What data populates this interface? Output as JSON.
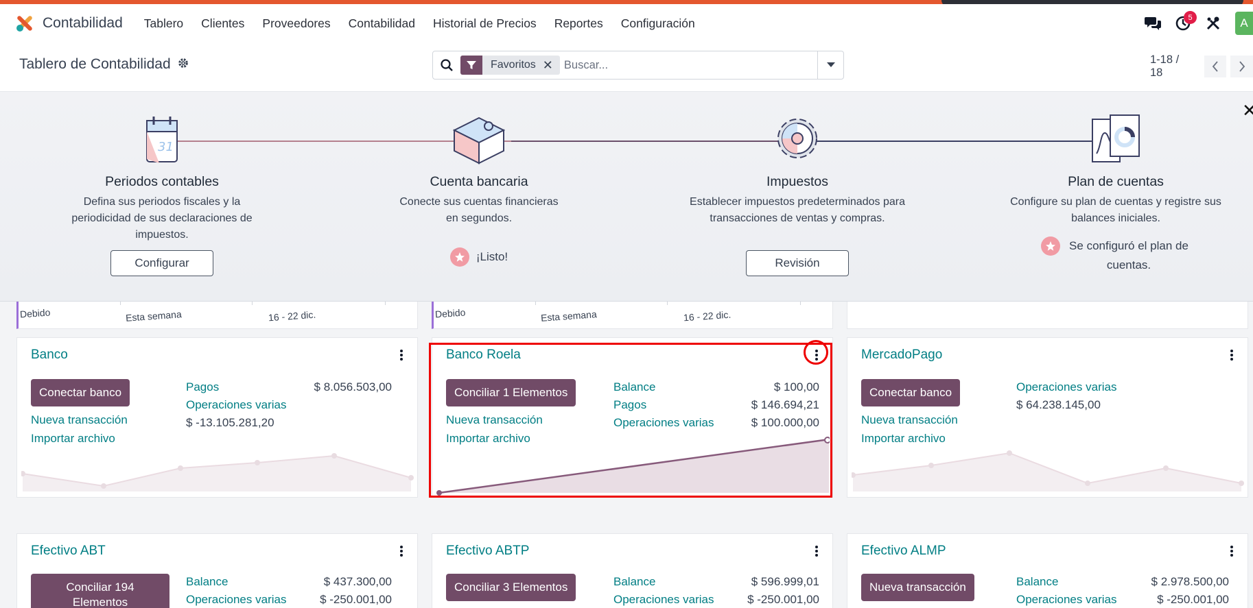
{
  "app": {
    "name": "Contabilidad",
    "menu": [
      "Tablero",
      "Clientes",
      "Proveedores",
      "Contabilidad",
      "Historial de Precios",
      "Reportes",
      "Configuración"
    ],
    "activity_count": "5",
    "avatar_letter": "A"
  },
  "control": {
    "title": "Tablero de Contabilidad",
    "facet_label": "Favoritos",
    "search_placeholder": "Buscar...",
    "pager_value": "1-18 / 18"
  },
  "onboarding": {
    "steps": [
      {
        "title": "Periodos contables",
        "desc": "Defina sus periodos fiscales y la periodicidad de sus declaraciones de impuestos.",
        "action": "Configurar",
        "icon": "calendar-icon"
      },
      {
        "title": "Cuenta bancaria",
        "desc": "Conecte sus cuentas financieras en segundos.",
        "done": "¡Listo!",
        "icon": "puzzle-box-icon"
      },
      {
        "title": "Impuestos",
        "desc": "Establecer impuestos predeterminados para transacciones de ventas y compras.",
        "action": "Revisión",
        "icon": "cog-icon"
      },
      {
        "title": "Plan de cuentas",
        "desc": "Configure su plan de cuentas y registre sus balances iniciales.",
        "done": "Se configuró el plan de cuentas.",
        "icon": "charts-icon"
      }
    ]
  },
  "partial_row": {
    "labels": [
      "Debido",
      "Esta semana",
      "16 - 22 dic."
    ]
  },
  "cards": [
    {
      "title": "Banco",
      "button": "Conectar banco",
      "links": [
        "Nueva transacción",
        "Importar archivo"
      ],
      "stats": [
        {
          "label": "Pagos",
          "value": "$ 8.056.503,00"
        },
        {
          "label": "Operaciones varias",
          "value": ""
        }
      ],
      "extra_line": "$ -13.105.281,20"
    },
    {
      "title": "Banco Roela",
      "button": "Conciliar 1 Elementos",
      "links": [
        "Nueva transacción",
        "Importar archivo"
      ],
      "stats": [
        {
          "label": "Balance",
          "value": "$ 100,00"
        },
        {
          "label": "Pagos",
          "value": "$ 146.694,21"
        },
        {
          "label": "Operaciones varias",
          "value": "$ 100.000,00"
        }
      ]
    },
    {
      "title": "MercadoPago",
      "button": "Conectar banco",
      "links": [
        "Nueva transacción",
        "Importar archivo"
      ],
      "stats": [
        {
          "label": "Operaciones varias",
          "value": ""
        }
      ],
      "extra_line": "$ 64.238.145,00"
    },
    {
      "title": "Efectivo ABT",
      "button": "Conciliar 194 Elementos",
      "stats": [
        {
          "label": "Balance",
          "value": "$ 437.300,00"
        },
        {
          "label": "Operaciones varias",
          "value": "$ -250.001,00"
        }
      ]
    },
    {
      "title": "Efectivo ABTP",
      "button": "Conciliar 3 Elementos",
      "stats": [
        {
          "label": "Balance",
          "value": "$ 596.999,01"
        },
        {
          "label": "Operaciones varias",
          "value": "$ -250.001,00"
        }
      ]
    },
    {
      "title": "Efectivo ALMP",
      "button": "Nueva transacción",
      "stats": [
        {
          "label": "Balance",
          "value": "$ 2.978.500,00"
        },
        {
          "label": "Operaciones varias",
          "value": "$ -250.001,00"
        }
      ]
    }
  ],
  "colors": {
    "primary": "#714b67",
    "link": "#017e84",
    "highlight": "#ee0000"
  }
}
